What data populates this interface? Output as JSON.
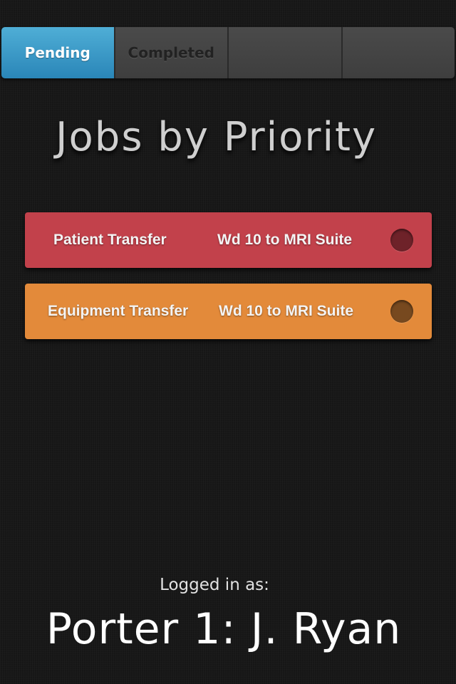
{
  "tabs": [
    {
      "label": "Pending",
      "active": true
    },
    {
      "label": "Completed",
      "active": false
    },
    {
      "label": "",
      "active": false
    },
    {
      "label": "",
      "active": false
    }
  ],
  "title": "Jobs by Priority",
  "jobs": [
    {
      "type": "Patient Transfer",
      "route": "Wd 10 to MRI Suite",
      "color": "#c2414b",
      "status_color": "#6e2229"
    },
    {
      "type": "Equipment Transfer",
      "route": "Wd 10 to MRI Suite",
      "color": "#e38a3a",
      "status_color": "#77491f"
    }
  ],
  "footer": {
    "logged_in_label": "Logged in as:",
    "user": "Porter 1: J. Ryan"
  },
  "colors": {
    "background": "#181818",
    "active_tab": "#3b9ac8",
    "inactive_tab": "#444444"
  }
}
